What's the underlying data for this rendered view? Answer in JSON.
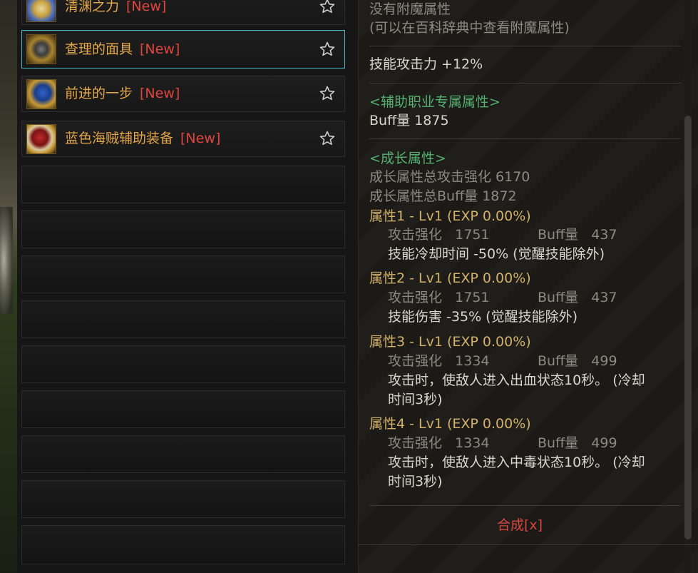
{
  "items": [
    {
      "name": "清渊之力",
      "tag": "[New]",
      "icon": "accessory-item-icon"
    },
    {
      "name": "查理的面具",
      "tag": "[New]",
      "icon": "mask-item-icon"
    },
    {
      "name": "前进的一步",
      "tag": "[New]",
      "icon": "step-item-icon"
    },
    {
      "name": "蓝色海贼辅助装备",
      "tag": "[New]",
      "icon": "pirate-item-icon"
    }
  ],
  "detail": {
    "no_enchant": "没有附魔属性",
    "enchant_hint": "(可以在百科辞典中查看附魔属性)",
    "skill_attack": "技能攻击力   +12%",
    "support_header": "<辅助职业专属属性>",
    "buff_amount": "Buff量   1875",
    "growth_header": "<成长属性>",
    "growth_total_attack": "成长属性总攻击强化 6170",
    "growth_total_buff": "成长属性总Buff量 1872",
    "attrs": [
      {
        "title": "属性1 - Lv1 (EXP 0.00%)",
        "atk_label": "攻击强化",
        "atk": "1751",
        "buff_label": "Buff量",
        "buff": "437",
        "effect": "技能冷却时间 -50% (觉醒技能除外)",
        "effect2": ""
      },
      {
        "title": "属性2 - Lv1 (EXP 0.00%)",
        "atk_label": "攻击强化",
        "atk": "1751",
        "buff_label": "Buff量",
        "buff": "437",
        "effect": "技能伤害 -35% (觉醒技能除外)",
        "effect2": ""
      },
      {
        "title": "属性3 - Lv1 (EXP 0.00%)",
        "atk_label": "攻击强化",
        "atk": "1334",
        "buff_label": "Buff量",
        "buff": "499",
        "effect": "攻击时，使敌人进入出血状态10秒。 (冷却",
        "effect2": "时间3秒)"
      },
      {
        "title": "属性4 - Lv1 (EXP 0.00%)",
        "atk_label": "攻击强化",
        "atk": "1334",
        "buff_label": "Buff量",
        "buff": "499",
        "effect": "攻击时，使敌人进入中毒状态10秒。 (冷却",
        "effect2": "时间3秒)"
      }
    ],
    "synth_link": "合成[x]"
  },
  "colors": {
    "name": "#e3a64a",
    "new": "#e0463e",
    "green": "#55b070",
    "gold": "#d2b06a",
    "selected_border": "#4fb8c8"
  }
}
